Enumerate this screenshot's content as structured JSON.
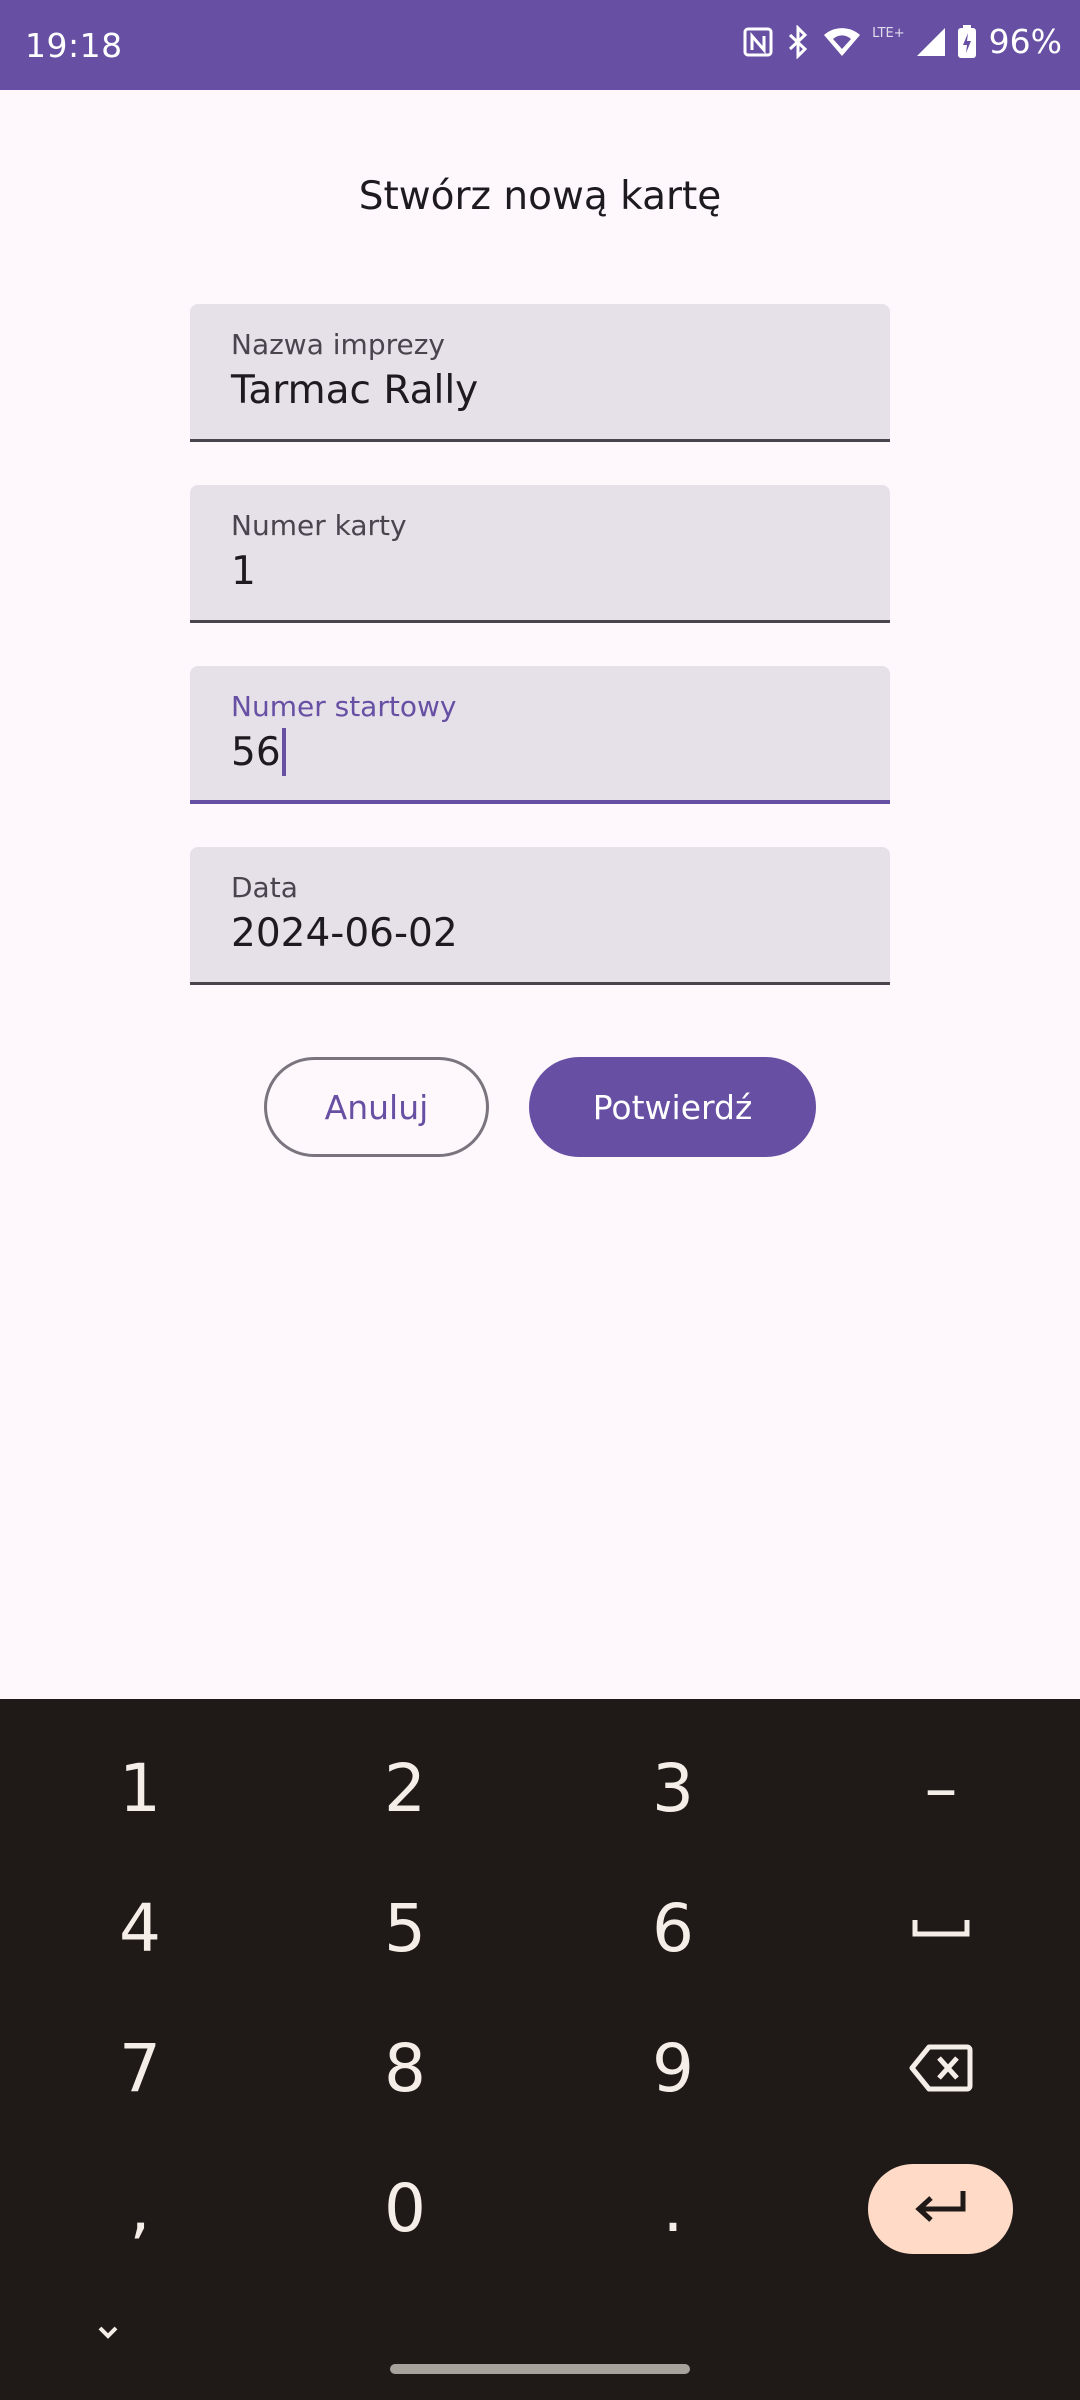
{
  "status_bar": {
    "time": "19:18",
    "battery": "96%",
    "network": "LTE+"
  },
  "dialog": {
    "title": "Stwórz nową kartę",
    "fields": [
      {
        "label": "Nazwa imprezy",
        "value": "Tarmac Rally",
        "focused": false
      },
      {
        "label": "Numer karty",
        "value": "1",
        "focused": false
      },
      {
        "label": "Numer startowy",
        "value": "56",
        "focused": true
      },
      {
        "label": "Data",
        "value": "2024-06-02",
        "focused": false
      }
    ],
    "cancel_label": "Anuluj",
    "confirm_label": "Potwierdź"
  },
  "keyboard": {
    "keys": [
      "1",
      "2",
      "3",
      "–",
      "4",
      "5",
      "6",
      "7",
      "8",
      "9",
      ",",
      "0",
      "."
    ],
    "icons": [
      "space-icon",
      "backspace-icon",
      "enter-icon",
      "hide-keyboard-icon"
    ]
  },
  "colors": {
    "primary": "#6750a4",
    "background": "#fef7fc",
    "field_fill": "#e6e0e9",
    "keyboard_bg": "#1f1a17",
    "enter_key": "#ffdbc7"
  }
}
